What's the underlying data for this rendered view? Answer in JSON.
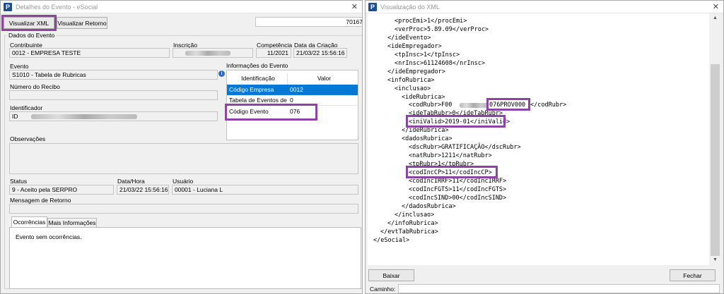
{
  "left": {
    "title": "Detalhes do Evento - eSocial",
    "btn_xml": "Visualizar XML",
    "btn_retorno": "Visualizar Retorno",
    "top_code": "70167",
    "group_title": "Dados do Evento",
    "contribuinte_label": "Contribuinte",
    "contribuinte_value": "0012 - EMPRESA TESTE",
    "inscricao_label": "Inscrição",
    "competencia_label": "Competência",
    "competencia_value": "11/2021",
    "data_criacao_label": "Data da Criação",
    "data_criacao_value": "21/03/22 15:56:16",
    "evento_label": "Evento",
    "evento_value": "S1010 - Tabela de Rubricas",
    "numero_recibo_label": "Número do Recibo",
    "identificador_label": "Identificador",
    "identificador_prefix": "ID",
    "info_title": "Informações do Evento",
    "info_headers": [
      "Identificação",
      "Valor"
    ],
    "info_rows": [
      {
        "id": "Código Empresa",
        "val": "0012"
      },
      {
        "id": "Tabela de Eventos de F",
        "val": "0"
      },
      {
        "id": "Código Evento",
        "val": "076"
      }
    ],
    "observacoes_label": "Observações",
    "status_label": "Status",
    "status_value": "9 - Aceito pela SERPRO",
    "datahora_label": "Data/Hora",
    "datahora_value": "21/03/22 15:56:16",
    "usuario_label": "Usuário",
    "usuario_value": "00001 - Luciana L",
    "mensagem_label": "Mensagem de Retorno",
    "tabs": [
      "Ocorrências",
      "Mais Informações"
    ],
    "ocorrencias_text": "Evento sem ocorrências."
  },
  "right": {
    "title": "Visualização do XML",
    "xml_lines": [
      "<procEmi>1</procEmi>",
      "<verProc>5.89.09</verProc>",
      "</ideEvento>",
      "<ideEmpregador>",
      "<tpInsc>1</tpInsc>",
      "<nrInsc>61124608</nrInsc>",
      "</ideEmpregador>",
      "<infoRubrica>",
      "<inclusao>",
      "<ideRubrica>",
      "<codRubr>F00",
      "076PROV000",
      "</codRubr>",
      "<ideTabRubr>0</ideTabRubr>",
      "<iniValid>2019-01</iniValid>",
      "</ideRubrica>",
      "<dadosRubrica>",
      "<dscRubr>GRATIFICAÇÃO</dscRubr>",
      "<natRubr>1211</natRubr>",
      "<tpRubr>1</tpRubr>",
      "<codIncCP>11</codIncCP>",
      "<codIncIRRF>11</codIncIRRF>",
      "<codIncFGTS>11</codIncFGTS>",
      "<codIncSIND>00</codIncSIND>",
      "</dadosRubrica>",
      "</inclusao>",
      "</infoRubrica>",
      "</evtTabRubrica>",
      "</eSocial>"
    ],
    "btn_baixar": "Baixar",
    "btn_fechar": "Fechar",
    "caminho_label": "Caminho:"
  }
}
